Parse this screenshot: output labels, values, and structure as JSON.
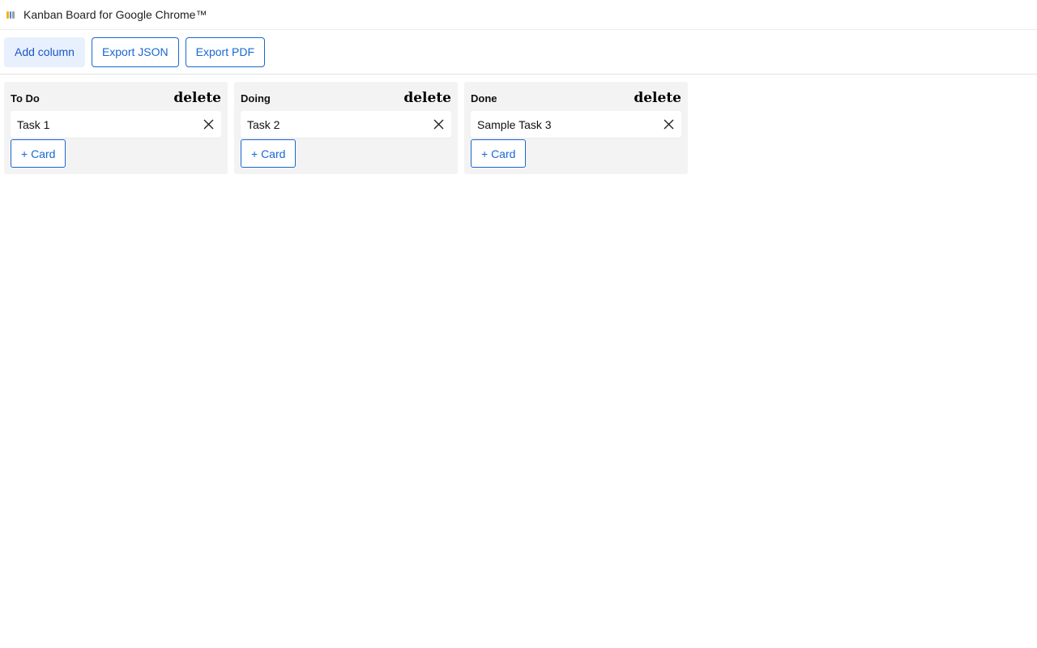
{
  "window": {
    "title": "Kanban Board for Google Chrome™",
    "icon": "kanban-app-icon",
    "icon_colors": [
      "#f4b400",
      "#4285f4",
      "#9aa0a6"
    ]
  },
  "toolbar": {
    "add_column_label": "Add column",
    "export_json_label": "Export JSON",
    "export_pdf_label": "Export PDF"
  },
  "columns": [
    {
      "title": "To Do",
      "delete_label": "delete",
      "cards": [
        "Task 1"
      ],
      "add_card_label": "+ Card"
    },
    {
      "title": "Doing",
      "delete_label": "delete",
      "cards": [
        "Task 2"
      ],
      "add_card_label": "+ Card"
    },
    {
      "title": "Done",
      "delete_label": "delete",
      "cards": [
        "Sample Task 3"
      ],
      "add_card_label": "+ Card"
    }
  ],
  "colors": {
    "accent": "#1967d2",
    "primary_button_bg": "#e8f0fe",
    "column_bg": "#f3f3f3"
  },
  "icons": {
    "card_remove": "close-icon"
  }
}
